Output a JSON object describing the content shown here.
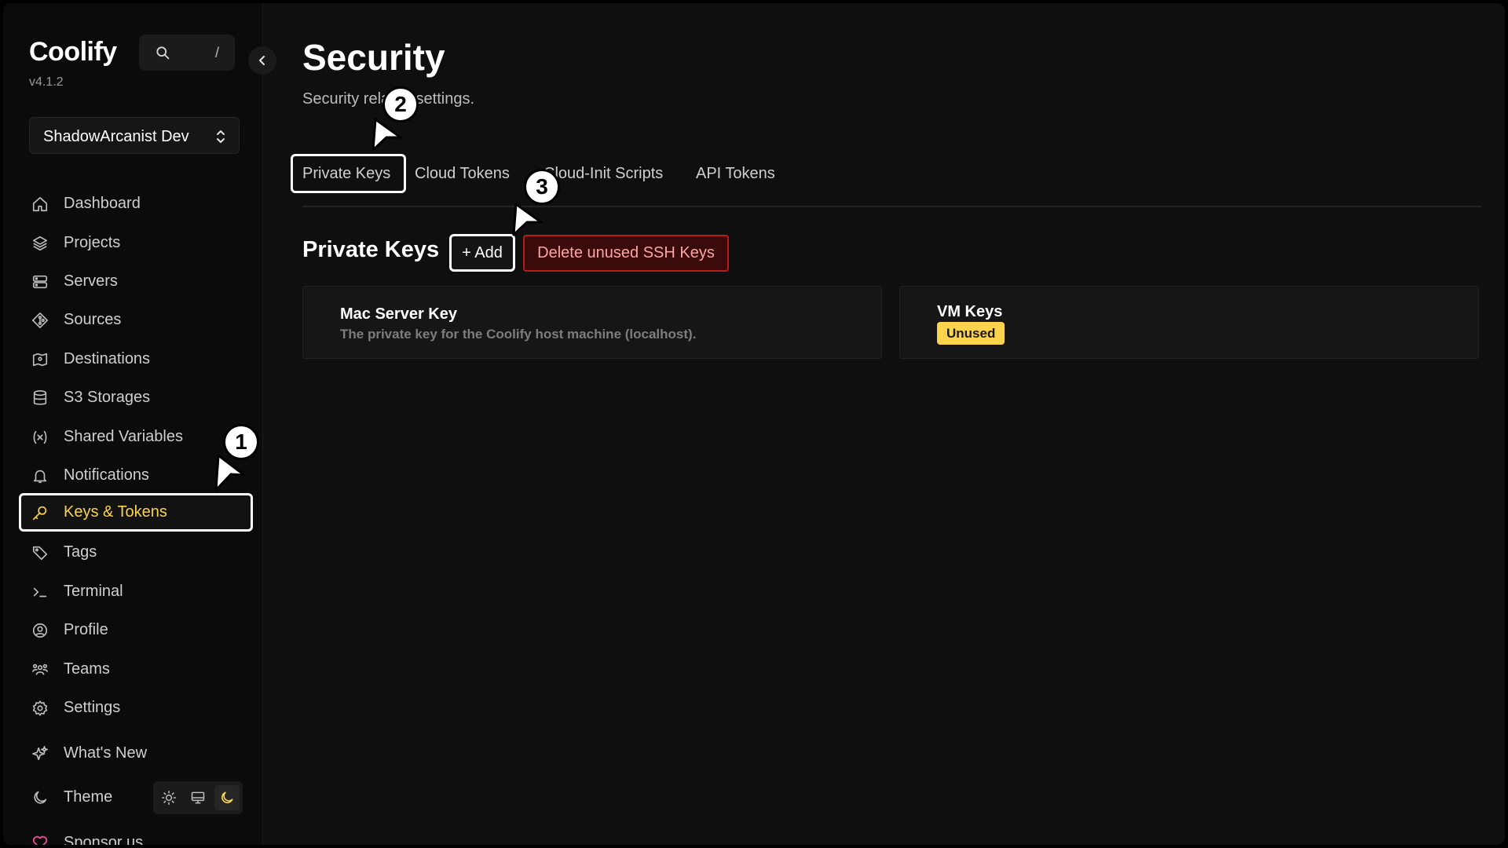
{
  "app": {
    "name": "Coolify",
    "version": "v4.1.2"
  },
  "search": {
    "shortcut": "/"
  },
  "team_selector": {
    "value": "ShadowArcanist Dev"
  },
  "sidebar": {
    "items": [
      {
        "label": "Dashboard",
        "icon": "home-icon"
      },
      {
        "label": "Projects",
        "icon": "layers-icon"
      },
      {
        "label": "Servers",
        "icon": "server-icon"
      },
      {
        "label": "Sources",
        "icon": "git-icon"
      },
      {
        "label": "Destinations",
        "icon": "destination-icon"
      },
      {
        "label": "S3 Storages",
        "icon": "database-icon"
      },
      {
        "label": "Shared Variables",
        "icon": "variable-icon"
      },
      {
        "label": "Notifications",
        "icon": "bell-icon"
      },
      {
        "label": "Keys & Tokens",
        "icon": "key-icon",
        "active": true
      },
      {
        "label": "Tags",
        "icon": "tag-icon"
      },
      {
        "label": "Terminal",
        "icon": "terminal-icon"
      },
      {
        "label": "Profile",
        "icon": "user-circle-icon"
      },
      {
        "label": "Teams",
        "icon": "users-icon"
      },
      {
        "label": "Settings",
        "icon": "gear-icon"
      },
      {
        "label": "What's New",
        "icon": "sparkles-icon"
      }
    ],
    "theme": {
      "label": "Theme",
      "options": [
        "sun-icon",
        "monitor-icon",
        "moon-icon"
      ],
      "selected": "moon-icon"
    },
    "sponsor_label": "Sponsor us",
    "accent_color": "#fcd34d"
  },
  "main": {
    "title": "Security",
    "subtitle": "Security related settings.",
    "tabs": [
      {
        "label": "Private Keys",
        "active": true
      },
      {
        "label": "Cloud Tokens"
      },
      {
        "label": "Cloud-Init Scripts"
      },
      {
        "label": "API Tokens"
      }
    ],
    "section_title": "Private Keys",
    "add_label": "+ Add",
    "delete_label": "Delete unused SSH Keys",
    "keys": [
      {
        "name": "Mac Server Key",
        "description": "The private key for the Coolify host machine (localhost)."
      },
      {
        "name": "VM Keys",
        "badge": "Unused"
      }
    ]
  },
  "annotations": [
    "1",
    "2",
    "3"
  ]
}
